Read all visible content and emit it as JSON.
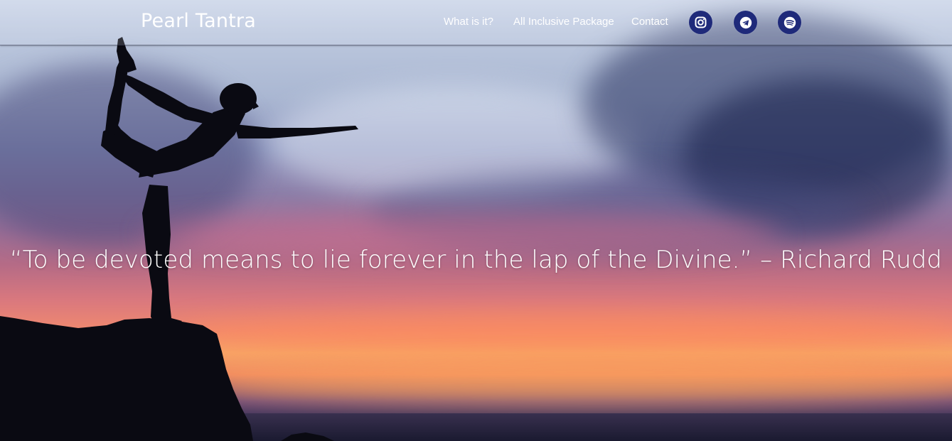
{
  "brand": {
    "title": "Pearl Tantra"
  },
  "nav": {
    "items": [
      {
        "label": "What is it?"
      },
      {
        "label": "All Inclusive Package"
      },
      {
        "label": "Contact"
      }
    ],
    "social": [
      {
        "icon": "instagram-icon"
      },
      {
        "icon": "telegram-icon"
      },
      {
        "icon": "spotify-icon"
      }
    ]
  },
  "hero": {
    "quote": "“To be devoted means to lie forever in the lap of the Divine.” – Richard Rudd"
  },
  "colors": {
    "social_bg": "#1f2a7a",
    "text": "#ffffff"
  }
}
